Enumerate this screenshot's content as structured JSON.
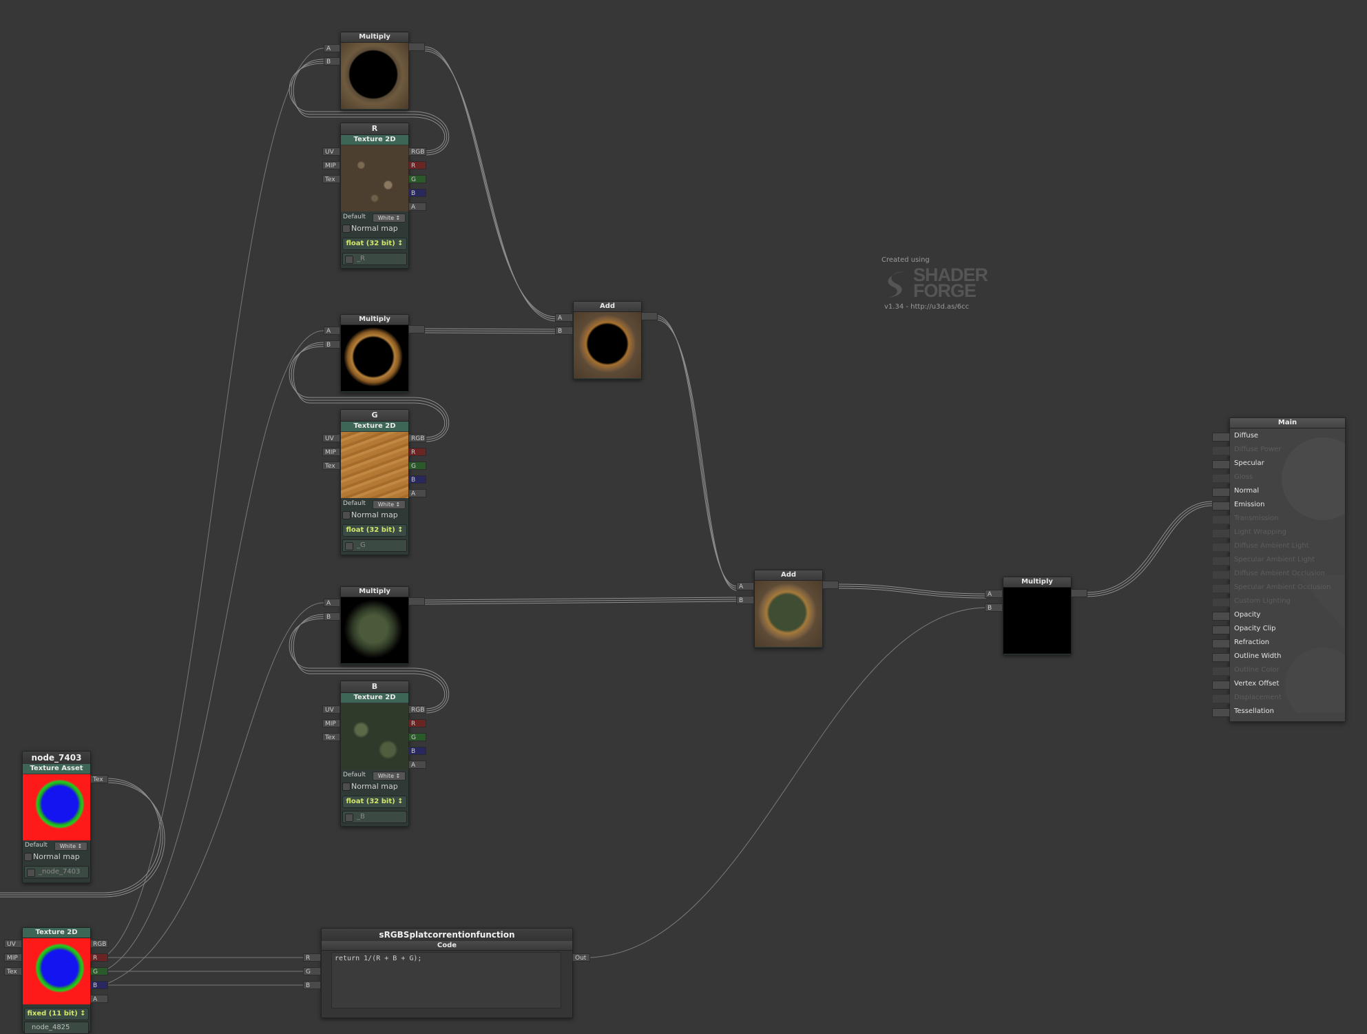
{
  "branding": {
    "created": "Created using",
    "line1": "SHADER",
    "line2": "FORGE",
    "version": "v1.34 - http://u3d.as/6cc"
  },
  "multiply1": {
    "title": "Multiply",
    "in_a": "A",
    "in_b": "B"
  },
  "multiply2": {
    "title": "Multiply",
    "in_a": "A",
    "in_b": "B"
  },
  "multiply3": {
    "title": "Multiply",
    "in_a": "A",
    "in_b": "B"
  },
  "add1": {
    "title": "Add",
    "in_a": "A",
    "in_b": "B"
  },
  "add2": {
    "title": "Add",
    "in_a": "A",
    "in_b": "B"
  },
  "multiply_final": {
    "title": "Multiply",
    "in_a": "A",
    "in_b": "B"
  },
  "texR": {
    "name": "R",
    "type": "Texture 2D",
    "inputs": [
      "UV",
      "MIP",
      "Tex"
    ],
    "outputs": [
      "RGB",
      "R",
      "G",
      "B",
      "A"
    ],
    "default_label": "Default",
    "default_value": "White",
    "normal_map": "Normal map",
    "precision": "float (32 bit)",
    "var": "_R"
  },
  "texG": {
    "name": "G",
    "type": "Texture 2D",
    "inputs": [
      "UV",
      "MIP",
      "Tex"
    ],
    "outputs": [
      "RGB",
      "R",
      "G",
      "B",
      "A"
    ],
    "default_label": "Default",
    "default_value": "White",
    "normal_map": "Normal map",
    "precision": "float (32 bit)",
    "var": "_G"
  },
  "texB": {
    "name": "B",
    "type": "Texture 2D",
    "inputs": [
      "UV",
      "MIP",
      "Tex"
    ],
    "outputs": [
      "RGB",
      "R",
      "G",
      "B",
      "A"
    ],
    "default_label": "Default",
    "default_value": "White",
    "normal_map": "Normal map",
    "precision": "float (32 bit)",
    "var": "_B"
  },
  "asset": {
    "name": "node_7403",
    "type": "Texture Asset",
    "out": "Tex",
    "default_label": "Default",
    "default_value": "White",
    "normal_map": "Normal map",
    "var": "_node_7403"
  },
  "tex2d": {
    "type": "Texture 2D",
    "inputs": [
      "UV",
      "MIP",
      "Tex"
    ],
    "outputs": [
      "RGB",
      "R",
      "G",
      "B",
      "A"
    ],
    "precision": "fixed (11 bit)",
    "var": "node_4825"
  },
  "func": {
    "name": "sRGBSplatcorrentionfunction",
    "sub": "Code",
    "inputs": [
      "R",
      "G",
      "B"
    ],
    "output": "Out",
    "code": "return 1/(R + B + G);"
  },
  "main": {
    "title": "Main",
    "rows": [
      {
        "label": "Diffuse",
        "on": true
      },
      {
        "label": "Diffuse Power",
        "on": false
      },
      {
        "label": "Specular",
        "on": true
      },
      {
        "label": "Gloss",
        "on": false
      },
      {
        "label": "Normal",
        "on": true
      },
      {
        "label": "Emission",
        "on": true
      },
      {
        "label": "Transmission",
        "on": false
      },
      {
        "label": "Light Wrapping",
        "on": false
      },
      {
        "label": "Diffuse Ambient Light",
        "on": false
      },
      {
        "label": "Specular Ambient Light",
        "on": false
      },
      {
        "label": "Diffuse Ambient Occlusion",
        "on": false
      },
      {
        "label": "Specular Ambient Occlusion",
        "on": false
      },
      {
        "label": "Custom Lighting",
        "on": false
      },
      {
        "label": "Opacity",
        "on": true
      },
      {
        "label": "Opacity Clip",
        "on": true
      },
      {
        "label": "Refraction",
        "on": true
      },
      {
        "label": "Outline Width",
        "on": true
      },
      {
        "label": "Outline Color",
        "on": false
      },
      {
        "label": "Vertex Offset",
        "on": true
      },
      {
        "label": "Displacement",
        "on": false
      },
      {
        "label": "Tessellation",
        "on": true
      }
    ]
  }
}
